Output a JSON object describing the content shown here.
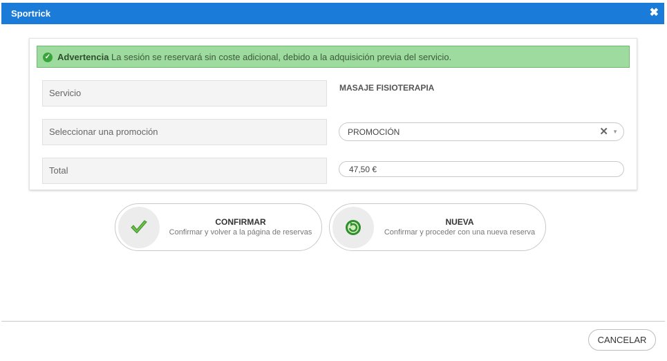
{
  "window": {
    "title": "Sportrick",
    "close_glyph": "✖"
  },
  "alert": {
    "icon": "check-circle-icon",
    "title": "Advertencia",
    "message": "La sesión se reservará sin coste adicional, debido a la adquisición previa del servicio."
  },
  "form": {
    "service_label": "Servicio",
    "service_value": "MASAJE FISIOTERAPIA",
    "promo_label": "Seleccionar una promoción",
    "promo_value": "PROMOCIÓN",
    "total_label": "Total",
    "total_value": "47,50 €"
  },
  "actions": {
    "confirm": {
      "title": "CONFIRMAR",
      "subtitle": "Confirmar y volver a la página de reservas"
    },
    "new": {
      "title": "NUEVA",
      "subtitle": "Confirmar y proceder con una nueva reserva"
    },
    "cancel": "CANCELAR"
  },
  "colors": {
    "titlebar": "#1a7bd8",
    "alert_bg": "#9edb9e",
    "alert_border": "#6fb86f"
  }
}
